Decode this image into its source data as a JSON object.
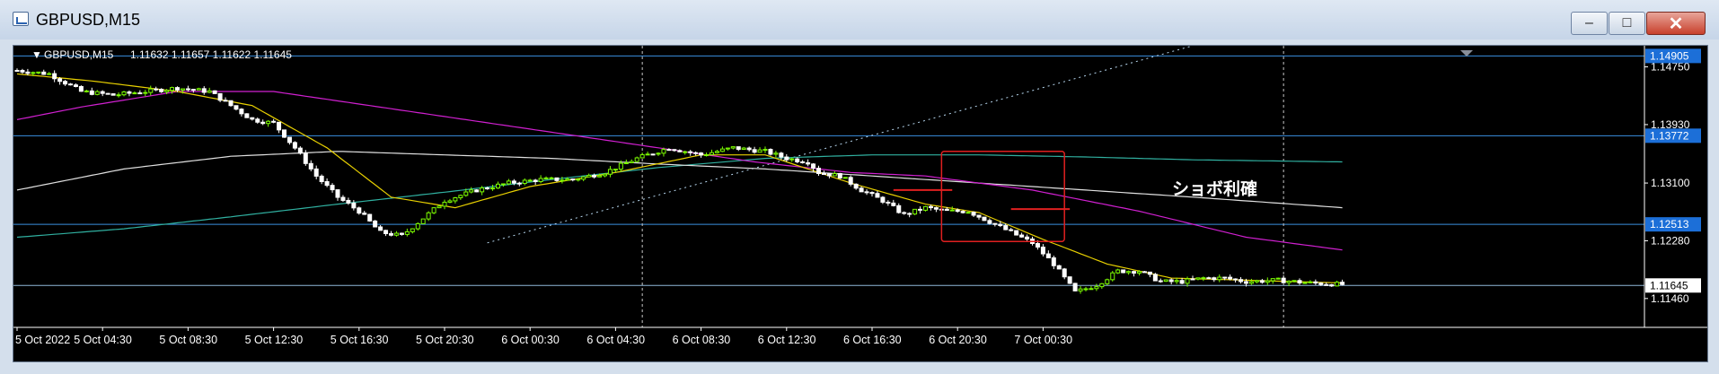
{
  "window": {
    "title": "GBPUSD,M15",
    "min_label": "–",
    "max_label": "□",
    "close_label": "✕"
  },
  "header": {
    "symbol": "GBPUSD,M15",
    "ohlc": "1.11632 1.11657 1.11622 1.11645"
  },
  "annotation": {
    "text": "ショボ利確"
  },
  "colors": {
    "background": "#000000",
    "bull": "#7CFC00",
    "bear": "#FFFFFF",
    "ma_short": "#E8D000",
    "ma_mid": "#D020D0",
    "ma_long_white": "#E0E0E0",
    "ma_long_teal": "#30B0A0",
    "hline": "#3A8FE0",
    "box": "#E02020"
  },
  "price_axis": {
    "labels": [
      "1.14750",
      "1.13930",
      "1.13100",
      "1.12280",
      "1.11460"
    ],
    "marked": [
      {
        "value": "1.14905",
        "style": "blue"
      },
      {
        "value": "1.13772",
        "style": "blue"
      },
      {
        "value": "1.12513",
        "style": "blue"
      },
      {
        "value": "1.11645",
        "style": "white"
      }
    ]
  },
  "time_axis": {
    "labels": [
      "5 Oct 2022",
      "5 Oct 04:30",
      "5 Oct 08:30",
      "5 Oct 12:30",
      "5 Oct 16:30",
      "5 Oct 20:30",
      "6 Oct 00:30",
      "6 Oct 04:30",
      "6 Oct 08:30",
      "6 Oct 12:30",
      "6 Oct 16:30",
      "6 Oct 20:30",
      "7 Oct 00:30"
    ]
  },
  "chart_data": {
    "type": "candlestick",
    "symbol": "GBPUSD",
    "timeframe": "M15",
    "ylim": [
      1.1105,
      1.1505
    ],
    "close_path": [
      [
        0,
        1.147
      ],
      [
        6,
        1.1465
      ],
      [
        12,
        1.144
      ],
      [
        18,
        1.1435
      ],
      [
        24,
        1.144
      ],
      [
        30,
        1.1445
      ],
      [
        36,
        1.144
      ],
      [
        40,
        1.142
      ],
      [
        44,
        1.14
      ],
      [
        48,
        1.1395
      ],
      [
        52,
        1.136
      ],
      [
        56,
        1.132
      ],
      [
        60,
        1.129
      ],
      [
        64,
        1.127
      ],
      [
        68,
        1.124
      ],
      [
        72,
        1.1235
      ],
      [
        76,
        1.126
      ],
      [
        80,
        1.1285
      ],
      [
        86,
        1.13
      ],
      [
        92,
        1.131
      ],
      [
        98,
        1.1315
      ],
      [
        104,
        1.1315
      ],
      [
        110,
        1.1325
      ],
      [
        116,
        1.1345
      ],
      [
        122,
        1.136
      ],
      [
        128,
        1.135
      ],
      [
        134,
        1.136
      ],
      [
        140,
        1.1355
      ],
      [
        144,
        1.1345
      ],
      [
        148,
        1.134
      ],
      [
        150,
        1.1325
      ],
      [
        154,
        1.132
      ],
      [
        158,
        1.13
      ],
      [
        162,
        1.1285
      ],
      [
        166,
        1.1265
      ],
      [
        170,
        1.1275
      ],
      [
        174,
        1.127
      ],
      [
        178,
        1.127
      ],
      [
        182,
        1.1255
      ],
      [
        186,
        1.124
      ],
      [
        190,
        1.1225
      ],
      [
        194,
        1.1195
      ],
      [
        198,
        1.1155
      ],
      [
        202,
        1.1165
      ],
      [
        206,
        1.1185
      ],
      [
        210,
        1.1185
      ],
      [
        214,
        1.117
      ],
      [
        218,
        1.117
      ],
      [
        222,
        1.1175
      ],
      [
        226,
        1.1175
      ],
      [
        230,
        1.117
      ],
      [
        236,
        1.1172
      ],
      [
        242,
        1.1168
      ],
      [
        248,
        1.1166
      ]
    ],
    "ma_short": [
      [
        0,
        1.1465
      ],
      [
        14,
        1.1455
      ],
      [
        30,
        1.144
      ],
      [
        44,
        1.142
      ],
      [
        58,
        1.136
      ],
      [
        70,
        1.129
      ],
      [
        82,
        1.1275
      ],
      [
        96,
        1.1305
      ],
      [
        112,
        1.1325
      ],
      [
        128,
        1.135
      ],
      [
        140,
        1.135
      ],
      [
        156,
        1.131
      ],
      [
        170,
        1.128
      ],
      [
        180,
        1.1268
      ],
      [
        192,
        1.123
      ],
      [
        204,
        1.1195
      ],
      [
        216,
        1.1175
      ],
      [
        230,
        1.1172
      ],
      [
        248,
        1.1168
      ]
    ],
    "ma_mid": [
      [
        0,
        1.14
      ],
      [
        12,
        1.1418
      ],
      [
        30,
        1.144
      ],
      [
        48,
        1.144
      ],
      [
        66,
        1.142
      ],
      [
        84,
        1.14
      ],
      [
        102,
        1.138
      ],
      [
        120,
        1.136
      ],
      [
        138,
        1.134
      ],
      [
        156,
        1.1325
      ],
      [
        170,
        1.132
      ],
      [
        190,
        1.13
      ],
      [
        210,
        1.127
      ],
      [
        230,
        1.1233
      ],
      [
        248,
        1.1215
      ]
    ],
    "ma_long_white": [
      [
        0,
        1.13
      ],
      [
        20,
        1.133
      ],
      [
        40,
        1.1348
      ],
      [
        60,
        1.1355
      ],
      [
        80,
        1.135
      ],
      [
        100,
        1.1345
      ],
      [
        120,
        1.1337
      ],
      [
        140,
        1.133
      ],
      [
        160,
        1.132
      ],
      [
        180,
        1.131
      ],
      [
        200,
        1.13
      ],
      [
        220,
        1.129
      ],
      [
        248,
        1.1275
      ]
    ],
    "ma_long_teal": [
      [
        0,
        1.1233
      ],
      [
        20,
        1.1245
      ],
      [
        40,
        1.1262
      ],
      [
        60,
        1.128
      ],
      [
        80,
        1.1297
      ],
      [
        100,
        1.1315
      ],
      [
        120,
        1.1332
      ],
      [
        140,
        1.1345
      ],
      [
        160,
        1.135
      ],
      [
        180,
        1.135
      ],
      [
        200,
        1.1347
      ],
      [
        220,
        1.1343
      ],
      [
        248,
        1.134
      ]
    ],
    "hlines": [
      1.14905,
      1.13772,
      1.12513,
      1.11645
    ],
    "trendline": [
      [
        88,
        1.1225
      ],
      [
        220,
        1.1505
      ]
    ],
    "vlines": [
      117,
      237
    ],
    "box": {
      "x": [
        173,
        196
      ],
      "y": [
        1.1227,
        1.1355
      ]
    },
    "red_marks": [
      {
        "x": [
          164,
          175
        ],
        "y": 1.13
      },
      {
        "x": [
          186,
          197
        ],
        "y": 1.1273
      }
    ]
  }
}
